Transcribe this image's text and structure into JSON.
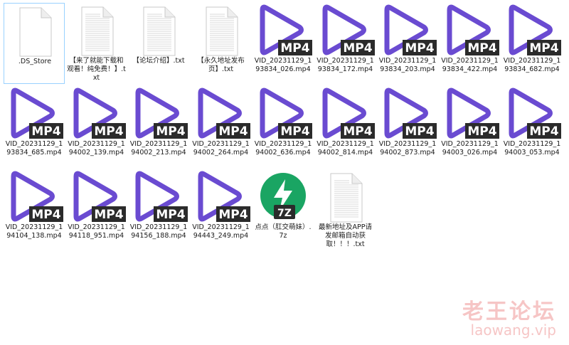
{
  "files": [
    {
      "name": ".DS_Store",
      "type": "generic"
    },
    {
      "name": "【来了就能下载和观看！纯免费！】.txt",
      "type": "text"
    },
    {
      "name": "【论坛介绍】.txt",
      "type": "text"
    },
    {
      "name": "【永久地址发布页】.txt",
      "type": "text"
    },
    {
      "name": "VID_20231129_193834_026.mp4",
      "type": "mp4"
    },
    {
      "name": "VID_20231129_193834_172.mp4",
      "type": "mp4"
    },
    {
      "name": "VID_20231129_193834_203.mp4",
      "type": "mp4"
    },
    {
      "name": "VID_20231129_193834_422.mp4",
      "type": "mp4"
    },
    {
      "name": "VID_20231129_193834_682.mp4",
      "type": "mp4"
    },
    {
      "name": "VID_20231129_193834_685.mp4",
      "type": "mp4"
    },
    {
      "name": "VID_20231129_194002_139.mp4",
      "type": "mp4"
    },
    {
      "name": "VID_20231129_194002_213.mp4",
      "type": "mp4"
    },
    {
      "name": "VID_20231129_194002_264.mp4",
      "type": "mp4"
    },
    {
      "name": "VID_20231129_194002_636.mp4",
      "type": "mp4"
    },
    {
      "name": "VID_20231129_194002_814.mp4",
      "type": "mp4"
    },
    {
      "name": "VID_20231129_194002_873.mp4",
      "type": "mp4"
    },
    {
      "name": "VID_20231129_194003_026.mp4",
      "type": "mp4"
    },
    {
      "name": "VID_20231129_194003_053.mp4",
      "type": "mp4"
    },
    {
      "name": "VID_20231129_194104_138.mp4",
      "type": "mp4"
    },
    {
      "name": "VID_20231129_194118_951.mp4",
      "type": "mp4"
    },
    {
      "name": "VID_20231129_194156_188.mp4",
      "type": "mp4"
    },
    {
      "name": "VID_20231129_194443_249.mp4",
      "type": "mp4"
    },
    {
      "name": "点点（肛交萌妹）.7z",
      "type": "7z"
    },
    {
      "name": "最新地址及APP请发邮箱自动获取！！！.txt",
      "type": "text"
    }
  ],
  "badges": {
    "mp4": "MP4",
    "7z": "7Z"
  },
  "colors": {
    "play_icon": "#6a4bd1",
    "badge_bg": "#2b2b2b",
    "archive_green": "#1aa563",
    "selection_border": "#99d1ff"
  },
  "icons": {
    "generic": "blank-file-icon",
    "text": "text-file-icon",
    "mp4": "mp4-video-icon",
    "7z": "7z-archive-icon"
  },
  "watermark": {
    "cn": "老王论坛",
    "en": "laowang.vip"
  }
}
